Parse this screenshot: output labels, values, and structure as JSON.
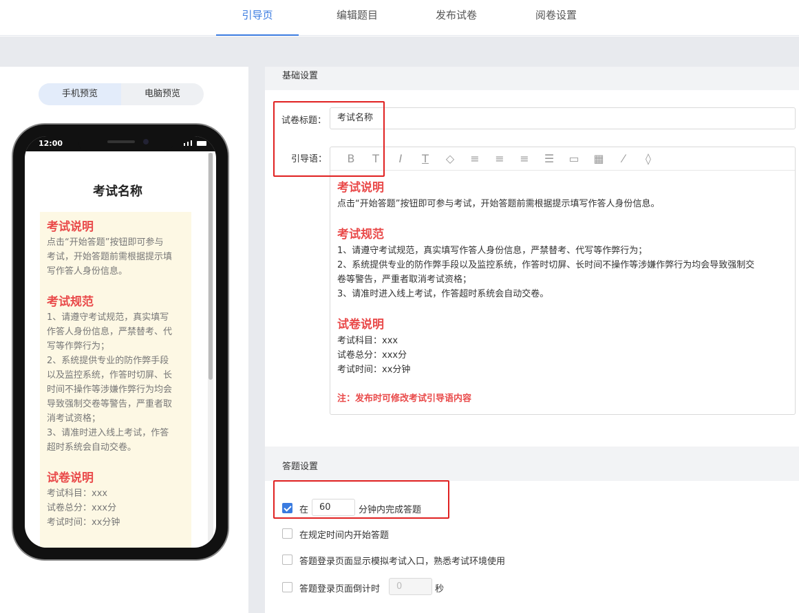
{
  "tabs": [
    {
      "label": "引导页",
      "active": true
    },
    {
      "label": "编辑题目",
      "active": false
    },
    {
      "label": "发布试卷",
      "active": false
    },
    {
      "label": "阅卷设置",
      "active": false
    }
  ],
  "preview": {
    "mobile_label": "手机预览",
    "desktop_label": "电脑预览",
    "status_time": "12:00",
    "title": "考试名称",
    "sections": [
      {
        "heading": "考试说明",
        "lines": [
          "点击“开始答题”按钮即可参与",
          "考试，开始答题前需根据提示填",
          "写作答人身份信息。"
        ]
      },
      {
        "heading": "考试规范",
        "lines": [
          "1、请遵守考试规范，真实填写",
          "作答人身份信息，严禁替考、代",
          "写等作弊行为；",
          "2、系统提供专业的防作弊手段",
          "以及监控系统，作答时切屏、长",
          "时间不操作等涉嫌作弊行为均会",
          "导致强制交卷等警告，严重者取",
          "消考试资格；",
          "3、请准时进入线上考试，作答",
          "超时系统会自动交卷。"
        ]
      },
      {
        "heading": "试卷说明",
        "lines": [
          "考试科目：xxx",
          "试卷总分：xxx分",
          "考试时间：xx分钟"
        ]
      }
    ]
  },
  "basic": {
    "section_title": "基础设置",
    "title_label": "试卷标题：",
    "title_value": "考试名称",
    "intro_label": "引导语：",
    "toolbar_icons": [
      "bold-icon",
      "font-size-icon",
      "italic-icon",
      "underline-icon",
      "fill-color-icon",
      "align-left-icon",
      "align-center-icon",
      "align-right-icon",
      "list-icon",
      "image-icon",
      "table-icon",
      "link-icon",
      "eraser-icon"
    ],
    "editor": {
      "h1": "考试说明",
      "p1": [
        "点击“开始答题”按钮即可参与考试，开始答题前需根据提示填写作答人身份信息。"
      ],
      "h2": "考试规范",
      "p2": [
        "1、请遵守考试规范，真实填写作答人身份信息，严禁替考、代写等作弊行为；",
        "2、系统提供专业的防作弊手段以及监控系统，作答时切屏、长时间不操作等涉嫌作弊行为均会导致强制交",
        "卷等警告，严重者取消考试资格；",
        "3、请准时进入线上考试，作答超时系统会自动交卷。"
      ],
      "h3": "试卷说明",
      "p3": [
        "考试科目：xxx",
        "试卷总分：xxx分",
        "考试时间：xx分钟"
      ],
      "note": "注：发布时可修改考试引导语内容"
    }
  },
  "answer": {
    "section_title": "答题设置",
    "opt1_prefix": "在",
    "opt1_value": "60",
    "opt1_suffix": "分钟内完成答题",
    "opt2": "在规定时间内开始答题",
    "opt3": "答题登录页面显示模拟考试入口，熟悉考试环境使用",
    "opt4_prefix": "答题登录页面倒计时",
    "opt4_value": "0",
    "opt4_suffix": "秒"
  }
}
